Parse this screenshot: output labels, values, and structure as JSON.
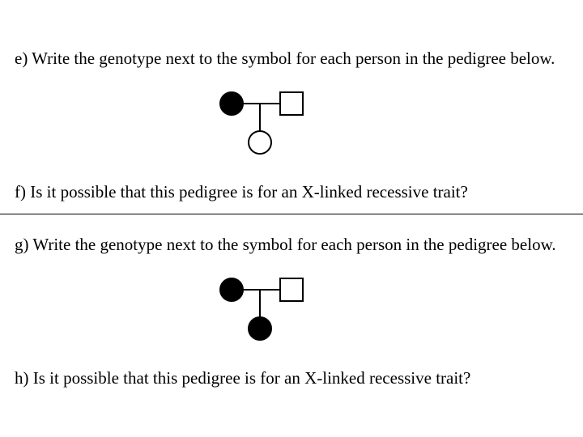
{
  "questions": {
    "e": "e) Write the genotype next to the symbol for each person in the pedigree below.",
    "f": "f) Is it possible that this pedigree is for an X-linked recessive trait?",
    "g": "g) Write the genotype next to the symbol for each person in the pedigree below.",
    "h": "h) Is it possible that this pedigree is for an X-linked recessive trait?"
  },
  "pedigrees": {
    "first": {
      "mother_affected": true,
      "father_affected": false,
      "child_sex": "female",
      "child_affected": false
    },
    "second": {
      "mother_affected": true,
      "father_affected": false,
      "child_sex": "female",
      "child_affected": true
    }
  }
}
